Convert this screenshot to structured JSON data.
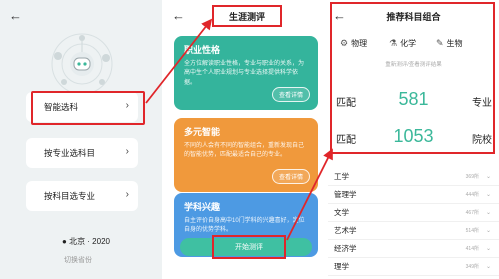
{
  "panel1": {
    "back_icon": "back-arrow-icon",
    "menu": [
      {
        "label": "智能选科"
      },
      {
        "label": "按专业选科目"
      },
      {
        "label": "按科目选专业"
      }
    ],
    "location": "北京 · 2020",
    "switch_province": "切换省份"
  },
  "panel2": {
    "title": "生涯测评",
    "cards": [
      {
        "title": "职业性格",
        "desc": "全方位解读职业性格，专业与职业的关系，为高中生个人职业规划与专业选择提供科学依据。",
        "button": "查看详情"
      },
      {
        "title": "多元智能",
        "desc": "不同的人会有不同的智能组合，重新发现自己的智能优势，匹配最适合自己的专业。",
        "button": "查看详情"
      },
      {
        "title": "学科兴趣",
        "desc": "自主评价自身高中10门学科的兴趣喜好，定位自身的优势学科。",
        "button": ""
      }
    ],
    "start_button": "开始测评"
  },
  "panel3": {
    "title": "推荐科目组合",
    "subjects": [
      "物理",
      "化学",
      "生物"
    ],
    "redo": "重新测评/查看测评结果",
    "match_label": "匹配",
    "major_count": "581",
    "major_label": "专业",
    "school_count": "1053",
    "school_label": "院校",
    "categories": [
      {
        "name": "工学",
        "count": "369所"
      },
      {
        "name": "管理学",
        "count": "444所"
      },
      {
        "name": "文学",
        "count": "467所"
      },
      {
        "name": "艺术学",
        "count": "514所"
      },
      {
        "name": "经济学",
        "count": "414所"
      },
      {
        "name": "理学",
        "count": "349所"
      }
    ]
  },
  "colors": {
    "highlight": "#e0262a",
    "teal": "#34b49c",
    "orange": "#f0993c",
    "blue": "#4d9ae3"
  }
}
